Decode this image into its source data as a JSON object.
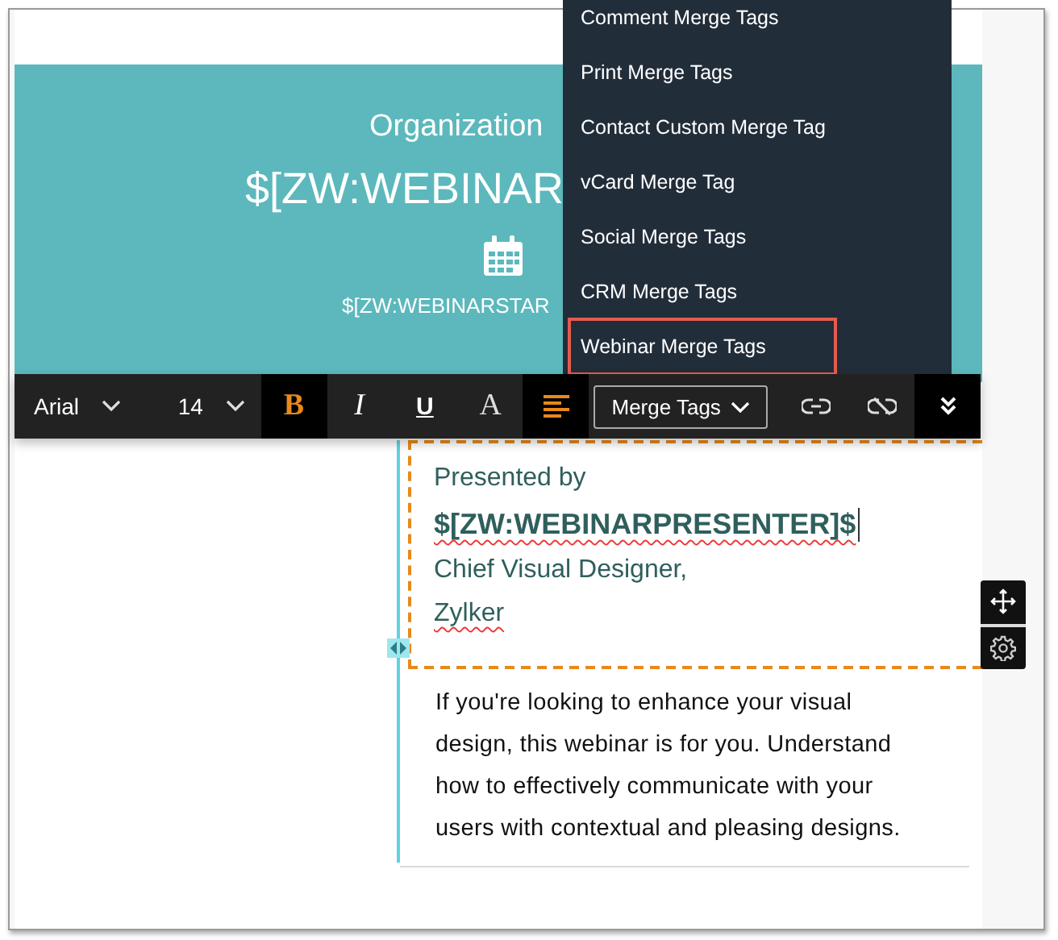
{
  "header": {
    "organization": "Organization",
    "webinar_tag": "$[ZW:WEBINAR",
    "start_tag": "$[ZW:WEBINARSTAR"
  },
  "toolbar": [
    {
      "kind": "select",
      "label": "Arial"
    },
    {
      "kind": "select",
      "label": "14"
    },
    {
      "kind": "bold",
      "label": "B",
      "active": true
    },
    {
      "kind": "italic",
      "label": "I",
      "active": false
    },
    {
      "kind": "underline",
      "label": "U",
      "active": false
    },
    {
      "kind": "font-color",
      "label": "A",
      "active": false
    },
    {
      "kind": "align",
      "active": true
    },
    {
      "kind": "dropdown",
      "label": "Merge Tags"
    },
    {
      "kind": "link",
      "active": false
    },
    {
      "kind": "unlink",
      "active": false
    },
    {
      "kind": "more",
      "active": true
    }
  ],
  "merge_menu": [
    {
      "label": "Comment Merge Tags",
      "selected": false
    },
    {
      "label": "Print Merge Tags",
      "selected": false
    },
    {
      "label": "Contact Custom Merge Tag",
      "selected": false
    },
    {
      "label": "vCard Merge Tag",
      "selected": false
    },
    {
      "label": "Social Merge Tags",
      "selected": false
    },
    {
      "label": "CRM Merge Tags",
      "selected": false
    },
    {
      "label": "Webinar Merge Tags",
      "selected": true
    }
  ],
  "presenter": {
    "intro": "Presented by",
    "name": "$[ZW:WEBINARPRESENTER]$",
    "title": "Chief Visual Designer,",
    "company": "Zylker"
  },
  "description": "If you're looking to enhance your visual design, this webinar is for you. Understand how to effectively communicate with your users with contextual and pleasing designs."
}
